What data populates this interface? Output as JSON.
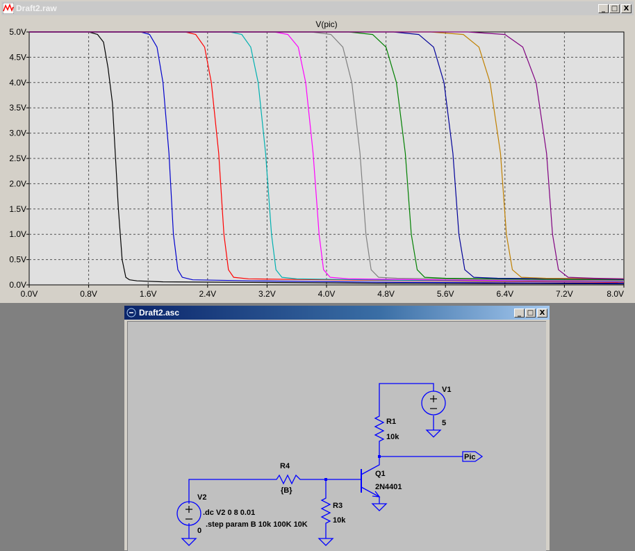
{
  "plot_window": {
    "title": "Draft2.raw",
    "buttons": {
      "minimize": "_",
      "maximize": "□",
      "close": "X"
    }
  },
  "schematic_window": {
    "title": "Draft2.asc",
    "buttons": {
      "minimize": "_",
      "maximize": "□",
      "close": "X"
    }
  },
  "schematic": {
    "wire_color": "#0000ff",
    "labels": {
      "v1_name": "V1",
      "v1_value": "5",
      "r1_name": "R1",
      "r1_value": "10k",
      "pic_label": "Pic",
      "q1_name": "Q1",
      "q1_model": "2N4401",
      "r4_name": "R4",
      "r4_value": "{B}",
      "r3_name": "R3",
      "r3_value": "10k",
      "v2_name": "V2",
      "v2_value": "0",
      "directive_dc": ".dc V2 0 8 0.01",
      "directive_step": ".step param B 10k 100K 10K"
    }
  },
  "chart_data": {
    "type": "line",
    "title": "V(pic)",
    "xlim": [
      0,
      8
    ],
    "ylim": [
      0,
      5
    ],
    "xticks": [
      "0.0V",
      "0.8V",
      "1.6V",
      "2.4V",
      "3.2V",
      "4.0V",
      "4.8V",
      "5.6V",
      "6.4V",
      "7.2V",
      "8.0V"
    ],
    "yticks": [
      "0.0V",
      "0.5V",
      "1.0V",
      "1.5V",
      "2.0V",
      "2.5V",
      "3.0V",
      "3.5V",
      "4.0V",
      "4.5V",
      "5.0V"
    ],
    "grid": true,
    "background": "#e0e0e0",
    "series": [
      {
        "color": "#000000",
        "x": [
          0,
          0.8,
          0.92,
          1.0,
          1.06,
          1.12,
          1.2,
          1.25,
          1.3,
          1.35,
          1.45,
          1.8,
          3,
          5,
          8
        ],
        "y": [
          5,
          5,
          4.95,
          4.8,
          4.3,
          3.6,
          1.5,
          0.5,
          0.15,
          0.1,
          0.08,
          0.06,
          0.05,
          0.03,
          0.02
        ]
      },
      {
        "color": "#0000cc",
        "x": [
          0,
          1.5,
          1.62,
          1.72,
          1.8,
          1.88,
          1.94,
          2.0,
          2.06,
          2.2,
          3,
          5,
          8
        ],
        "y": [
          5,
          5,
          4.95,
          4.7,
          4.0,
          2.6,
          1.0,
          0.3,
          0.15,
          0.1,
          0.08,
          0.05,
          0.03
        ]
      },
      {
        "color": "#ff0000",
        "x": [
          0,
          2.1,
          2.24,
          2.36,
          2.45,
          2.55,
          2.62,
          2.68,
          2.75,
          2.95,
          4,
          6,
          8
        ],
        "y": [
          5,
          5,
          4.95,
          4.7,
          4.0,
          2.6,
          1.0,
          0.3,
          0.15,
          0.12,
          0.1,
          0.07,
          0.05
        ]
      },
      {
        "color": "#00b0b0",
        "x": [
          0,
          2.7,
          2.86,
          2.98,
          3.08,
          3.18,
          3.26,
          3.32,
          3.4,
          3.6,
          5,
          8
        ],
        "y": [
          5,
          5,
          4.95,
          4.7,
          4.0,
          2.6,
          1.0,
          0.3,
          0.15,
          0.12,
          0.09,
          0.06
        ]
      },
      {
        "color": "#ff00ff",
        "x": [
          0,
          3.3,
          3.48,
          3.62,
          3.72,
          3.82,
          3.9,
          3.96,
          4.05,
          4.3,
          6,
          8
        ],
        "y": [
          5,
          5,
          4.95,
          4.7,
          4.0,
          2.6,
          1.0,
          0.3,
          0.15,
          0.12,
          0.09,
          0.07
        ]
      },
      {
        "color": "#808080",
        "x": [
          0,
          3.8,
          4.06,
          4.22,
          4.34,
          4.45,
          4.53,
          4.6,
          4.7,
          4.95,
          6.5,
          8
        ],
        "y": [
          5,
          5,
          4.95,
          4.7,
          4.0,
          2.6,
          1.0,
          0.3,
          0.15,
          0.13,
          0.1,
          0.08
        ]
      },
      {
        "color": "#008000",
        "x": [
          0,
          4.3,
          4.62,
          4.8,
          4.94,
          5.06,
          5.14,
          5.22,
          5.32,
          5.6,
          7,
          8
        ],
        "y": [
          5,
          5,
          4.95,
          4.7,
          4.0,
          2.6,
          1.0,
          0.3,
          0.15,
          0.13,
          0.11,
          0.1
        ]
      },
      {
        "color": "#000099",
        "x": [
          0,
          4.9,
          5.24,
          5.44,
          5.58,
          5.7,
          5.78,
          5.86,
          5.98,
          6.3,
          8
        ],
        "y": [
          5,
          5,
          4.95,
          4.7,
          4.0,
          2.6,
          1.0,
          0.3,
          0.15,
          0.13,
          0.11
        ]
      },
      {
        "color": "#c08000",
        "x": [
          0,
          5.4,
          5.84,
          6.05,
          6.2,
          6.34,
          6.42,
          6.5,
          6.62,
          6.95,
          8
        ],
        "y": [
          5,
          5,
          4.95,
          4.7,
          4.0,
          2.6,
          1.0,
          0.3,
          0.15,
          0.13,
          0.12
        ]
      },
      {
        "color": "#800080",
        "x": [
          0,
          5.9,
          6.4,
          6.64,
          6.82,
          6.96,
          7.04,
          7.12,
          7.25,
          7.6,
          8
        ],
        "y": [
          5,
          5,
          4.95,
          4.7,
          4.0,
          2.6,
          1.0,
          0.3,
          0.15,
          0.13,
          0.12
        ]
      }
    ]
  }
}
